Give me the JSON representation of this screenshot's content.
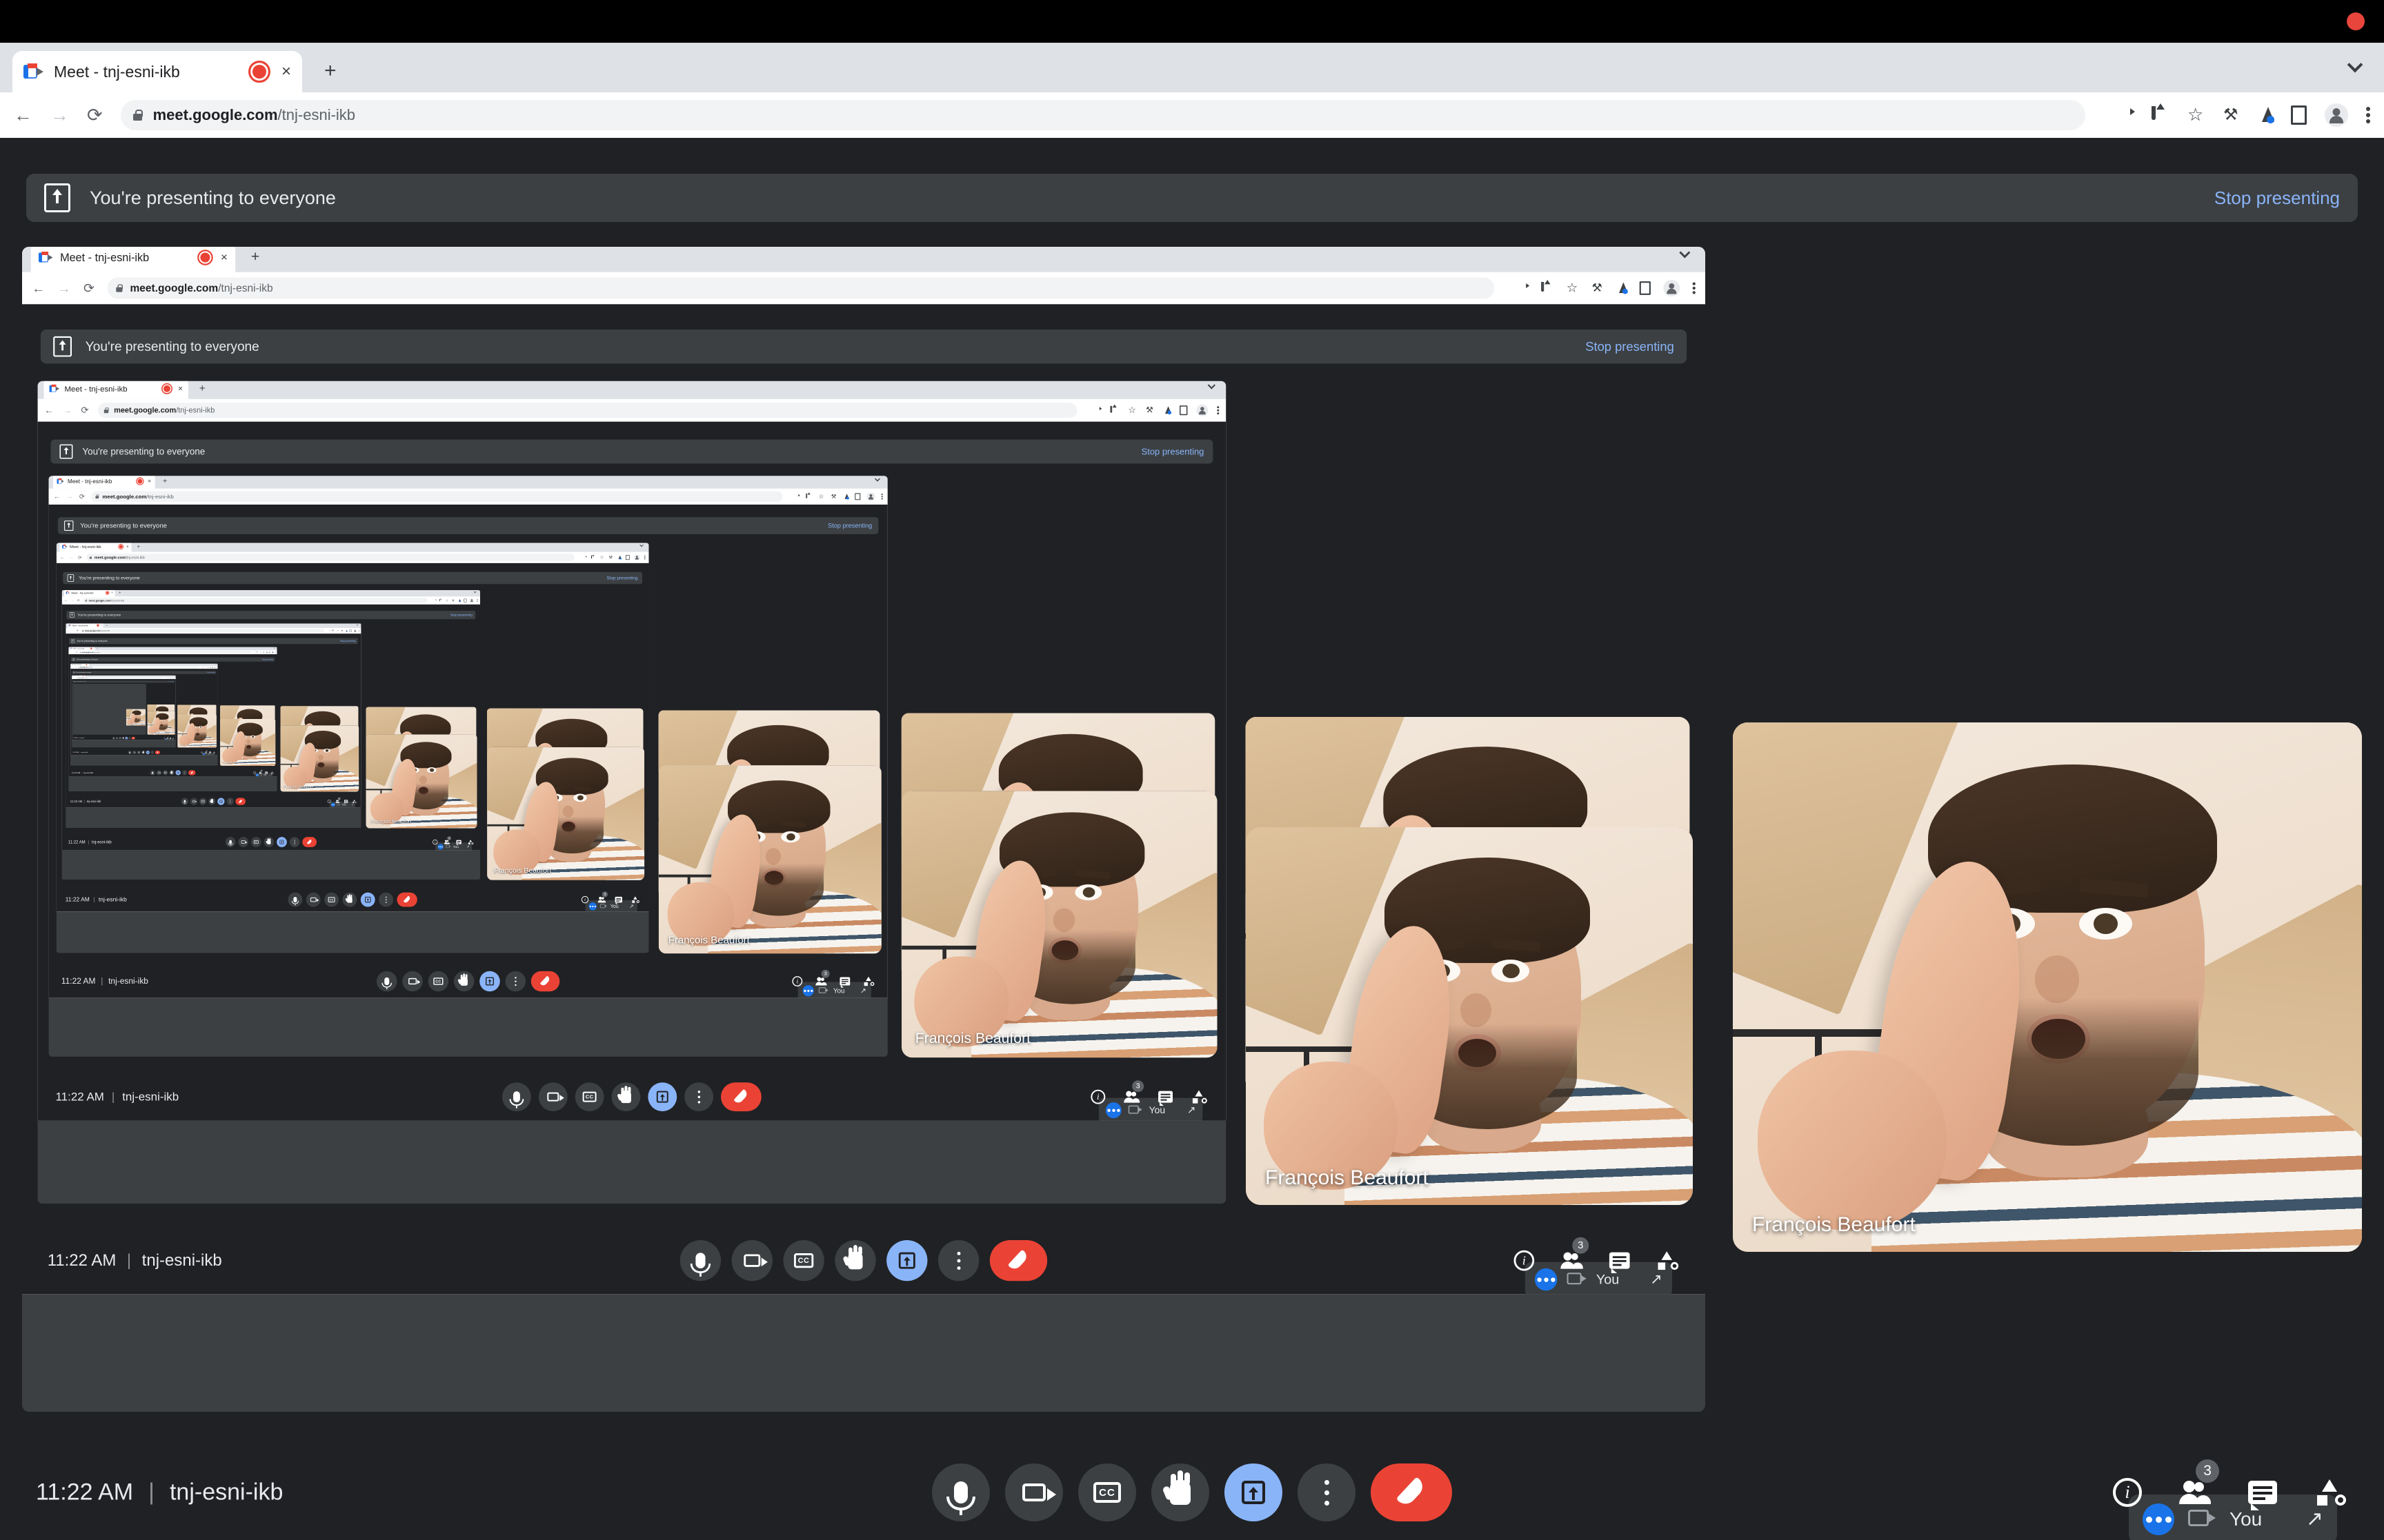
{
  "window": {
    "recording_indicator": "recording-dot"
  },
  "browser": {
    "tab": {
      "title": "Meet - tnj-esni-ikb",
      "favicon": "google-meet-icon",
      "recording_badge": "tab-recording-icon",
      "close_label": "×"
    },
    "new_tab_label": "+",
    "tab_search_icon": "chevron-down-icon",
    "nav": {
      "back": "←",
      "forward": "→",
      "reload": "⟳"
    },
    "omnibox": {
      "lock_icon": "lock-icon",
      "url_domain": "meet.google.com",
      "url_path": "/tnj-esni-ikb",
      "full_url": "meet.google.com/tnj-esni-ikb"
    },
    "toolbar_icons": [
      "media-cast-icon",
      "share-icon",
      "bookmark-star-icon",
      "extensions-puzzle-icon",
      "experiments-flask-icon",
      "side-panel-icon",
      "profile-avatar-icon",
      "chrome-menu-icon"
    ]
  },
  "meet": {
    "banner": {
      "icon": "present-screen-icon",
      "text": "You're presenting to everyone",
      "stop_label": "Stop presenting",
      "stop_color": "#8ab4f8"
    },
    "participant_name": "François Beaufort",
    "self_view": {
      "avatar_icon": "speaking-dots-icon",
      "camera_icon": "camera-off-icon",
      "label": "You",
      "expand_icon": "expand-arrow-icon"
    },
    "status": {
      "time": "11:22 AM",
      "separator": "|",
      "meeting_code": "tnj-esni-ikb"
    },
    "controls": [
      {
        "name": "microphone-button",
        "icon": "mic-icon",
        "active": false
      },
      {
        "name": "camera-button",
        "icon": "camera-icon",
        "active": false
      },
      {
        "name": "captions-button",
        "icon": "cc-icon",
        "label": "CC",
        "active": false
      },
      {
        "name": "raise-hand-button",
        "icon": "raise-hand-icon",
        "active": false
      },
      {
        "name": "present-now-button",
        "icon": "present-screen-icon",
        "active": true
      },
      {
        "name": "more-options-button",
        "icon": "more-vert-icon",
        "active": false
      },
      {
        "name": "leave-call-button",
        "icon": "end-call-icon",
        "active": false
      }
    ],
    "right_controls": [
      {
        "name": "meeting-details-button",
        "icon": "info-icon"
      },
      {
        "name": "participants-button",
        "icon": "people-icon",
        "badge": "3"
      },
      {
        "name": "chat-button",
        "icon": "chat-icon"
      },
      {
        "name": "activities-button",
        "icon": "activities-icon"
      }
    ],
    "colors": {
      "app_background": "#202124",
      "surface": "#3c4043",
      "accent_blue": "#8ab4f8",
      "danger_red": "#ea4335"
    }
  },
  "recursion": {
    "depth": 9,
    "note": "screen share of the same window, Droste effect"
  }
}
